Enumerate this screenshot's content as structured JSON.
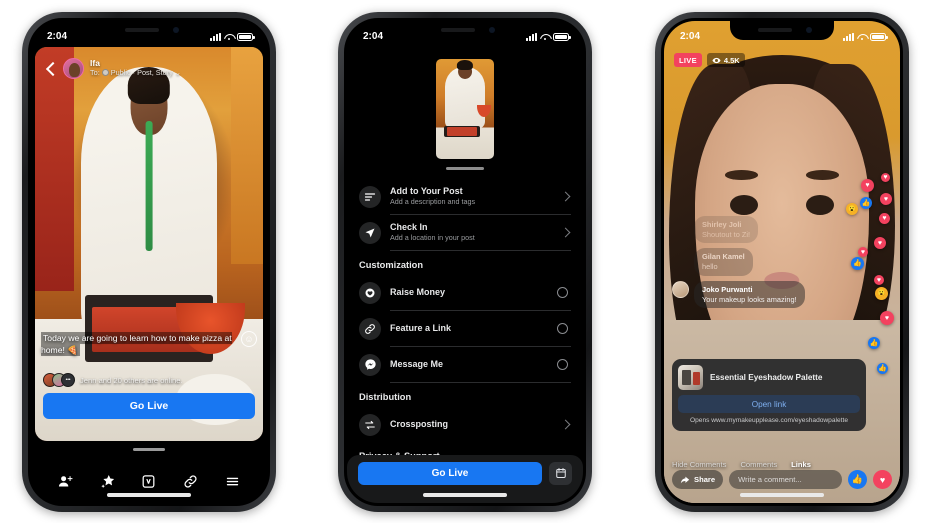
{
  "phone1": {
    "status": {
      "time": "2:04"
    },
    "header": {
      "back": "back-arrow",
      "user_name": "Ifa",
      "audience": "To: ",
      "audience_value": "Public · Post, Story",
      "chevron": "⌄"
    },
    "caption": "Today we are going to learn how to make pizza at home! 🍕",
    "emoji_button": "☺",
    "online_text": "Jenn and 20 others are online.",
    "go_live_label": "Go Live",
    "tabs": [
      {
        "name": "add-people-icon"
      },
      {
        "name": "effects-icon"
      },
      {
        "name": "video-badge-icon"
      },
      {
        "name": "link-icon"
      },
      {
        "name": "menu-icon"
      }
    ]
  },
  "phone2": {
    "status": {
      "time": "2:04"
    },
    "rows": [
      {
        "id": "add-to-your-post",
        "title": "Add to Your Post",
        "subtitle": "Add a description and tags",
        "icon": "description-lines-icon",
        "control": "chevron"
      },
      {
        "id": "check-in",
        "title": "Check In",
        "subtitle": "Add a location in your post",
        "icon": "location-arrow-icon",
        "control": "chevron"
      }
    ],
    "sections": [
      {
        "title": "Customization",
        "rows": [
          {
            "id": "raise-money",
            "title": "Raise Money",
            "icon": "donate-heart-icon",
            "control": "toggle"
          },
          {
            "id": "feature-a-link",
            "title": "Feature a Link",
            "icon": "link-icon",
            "control": "toggle"
          },
          {
            "id": "message-me",
            "title": "Message Me",
            "icon": "messenger-icon",
            "control": "toggle"
          }
        ]
      },
      {
        "title": "Distribution",
        "rows": [
          {
            "id": "crossposting",
            "title": "Crossposting",
            "icon": "crosspost-arrows-icon",
            "control": "chevron"
          }
        ]
      },
      {
        "title": "Privacy & Support",
        "rows": []
      }
    ],
    "footer": {
      "go_live_label": "Go Live",
      "schedule_icon": "calendar-icon"
    }
  },
  "phone3": {
    "status": {
      "time": "2:04"
    },
    "live_badge": "LIVE",
    "viewer_count": "4.5K",
    "eye_icon": "eye-icon",
    "comments": [
      {
        "name": "Shirley Joli",
        "text": "Shoutout to Zi!",
        "fade": "f1"
      },
      {
        "name": "Gilan Kamel",
        "text": "hello",
        "fade": "f2"
      },
      {
        "name": "Joko Purwanti",
        "text": "Your makeup looks amazing!",
        "fade": ""
      }
    ],
    "product": {
      "name": "Essential Eyeshadow Palette",
      "open_link_label": "Open link",
      "url_text": "Opens www.mymakeupplease.com/eyeshadowpalette"
    },
    "tabs": [
      {
        "label": "Hide Comments",
        "active": false
      },
      {
        "label": "Comments",
        "active": false
      },
      {
        "label": "Links",
        "active": true
      }
    ],
    "share_label": "Share",
    "comment_placeholder": "Write a comment...",
    "reaction_like": "👍",
    "reaction_heart": "♥",
    "reaction_wow": "😮"
  },
  "colors": {
    "facebook_blue": "#1877F2",
    "live_red": "#F3425F",
    "wow_yellow": "#F7B125",
    "surface_dark": "#18191A"
  }
}
